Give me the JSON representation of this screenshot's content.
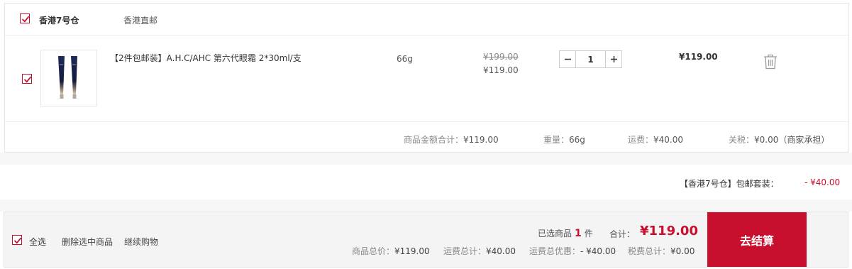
{
  "store": {
    "name": "香港7号仓",
    "tag": "香港直邮"
  },
  "item": {
    "title": "【2件包邮装】A.H.C/AHC 第六代眼霜 2*30ml/支",
    "weight": "66g",
    "original_price": "¥199.00",
    "price": "¥119.00",
    "quantity": "1",
    "subtotal": "¥119.00",
    "icons": {
      "delete": "trash-icon",
      "minus": "minus-icon",
      "plus": "plus-icon",
      "checkbox": "checkmark-icon"
    }
  },
  "summary": {
    "goods_total_label": "商品金额合计：",
    "goods_total_value": "¥119.00",
    "weight_label": "重量：",
    "weight_value": "66g",
    "shipping_label": "运费：",
    "shipping_value": "¥40.00",
    "tariff_label": "关税：",
    "tariff_value": "¥0.00（商家承担）"
  },
  "package": {
    "label": "【香港7号仓】包邮套装：",
    "amount": "- ¥40.00"
  },
  "footer": {
    "select_all": "全选",
    "delete_selected": "删除选中商品",
    "continue_shopping": "继续购物",
    "selected_prefix": "已选商品",
    "selected_count": "1",
    "selected_suffix": "件",
    "total_label": "合计：",
    "total_value": "¥119.00",
    "goods_total_label": "商品总价：",
    "goods_total_value": "¥119.00",
    "shipping_total_label": "运费总计：",
    "shipping_total_value": "¥40.00",
    "shipping_discount_label": "运费总优惠：",
    "shipping_discount_value": "- ¥40.00",
    "tax_total_label": "税费总计：",
    "tax_total_value": "¥0.00",
    "checkout_label": "去结算"
  },
  "colors": {
    "accent": "#c8102e",
    "border": "#e6e6e6",
    "footer_bg": "#f4f4f4"
  }
}
